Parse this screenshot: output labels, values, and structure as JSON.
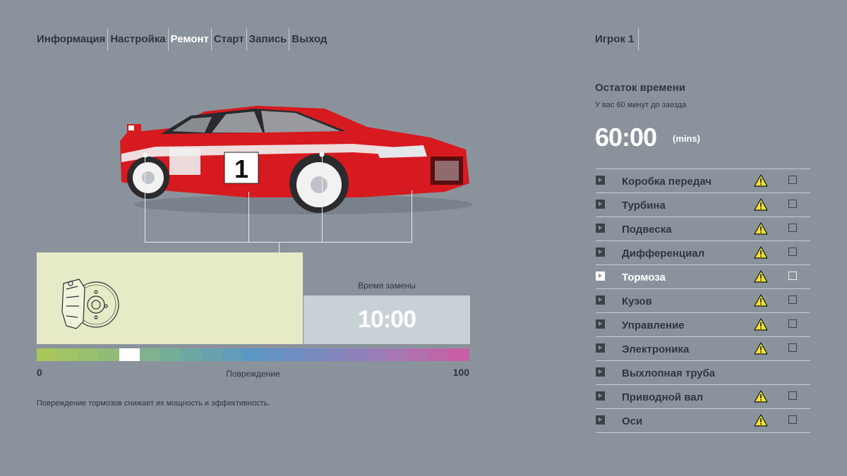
{
  "menu": [
    "Информация",
    "Настройка",
    "Ремонт",
    "Старт",
    "Запись",
    "Выход"
  ],
  "menu_active": 2,
  "player": "Игрок 1",
  "car": {
    "number": "1",
    "body_color": "#d61a1f"
  },
  "part": {
    "time_label": "Время замены",
    "time_value": "10:00",
    "damage_label": "Повреждение",
    "damage_min": "0",
    "damage_max": "100",
    "damage_level_fraction": 0.19,
    "description": "Повреждение тормозов снижает их мощность и эффективность."
  },
  "remaining": {
    "title": "Остаток времени",
    "subtitle": "У вас 60 минут до заезда",
    "value": "60:00",
    "unit": "(mins)"
  },
  "components": [
    {
      "name": "Коробка передач",
      "warning": true
    },
    {
      "name": "Турбина",
      "warning": true
    },
    {
      "name": "Подвеска",
      "warning": true
    },
    {
      "name": "Дифференциал",
      "warning": true
    },
    {
      "name": "Тормоза",
      "warning": true,
      "selected": true
    },
    {
      "name": "Кузов",
      "warning": true
    },
    {
      "name": "Управление",
      "warning": true
    },
    {
      "name": "Электроника",
      "warning": true
    },
    {
      "name": "Выхлопная труба",
      "warning": false
    },
    {
      "name": "Приводной вал",
      "warning": true
    },
    {
      "name": "Оси",
      "warning": true
    }
  ],
  "colors": {
    "accent": "#ffffff",
    "warning": "#f3e22a",
    "bar_gradient": [
      "#a8c65a",
      "#8dbb7a",
      "#6eaaa0",
      "#5c97c4",
      "#7a88c0",
      "#a27ab4",
      "#c85fa6"
    ]
  },
  "icons": {
    "row_arrow": "chevron-right-icon",
    "warning": "warning-triangle-icon",
    "checkbox": "checkbox-icon",
    "part": "brake-disc-icon"
  }
}
